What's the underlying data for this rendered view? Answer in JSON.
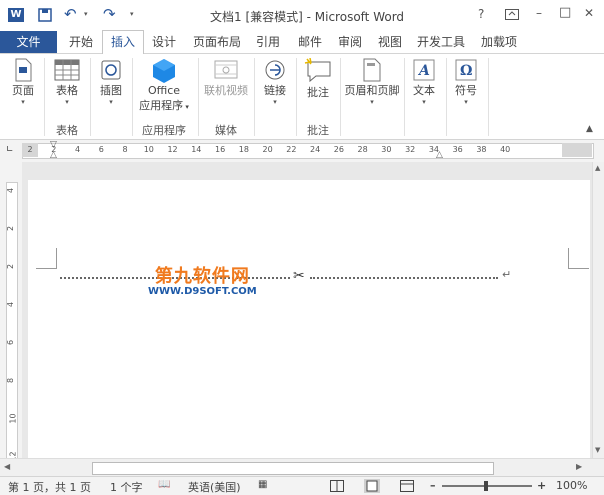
{
  "window": {
    "title": "文档1 [兼容模式] - Microsoft Word"
  },
  "quick_access": {
    "app_icon": "word-icon",
    "save_icon": "save-icon",
    "undo_icon": "undo-icon",
    "redo_icon": "redo-icon"
  },
  "window_controls": {
    "help": "?",
    "ribbon_display": "ribbon-display-icon",
    "minimize": "–",
    "maximize": "□",
    "close": "✕"
  },
  "tabs": [
    {
      "label": "文件"
    },
    {
      "label": "开始"
    },
    {
      "label": "插入"
    },
    {
      "label": "设计"
    },
    {
      "label": "页面布局"
    },
    {
      "label": "引用"
    },
    {
      "label": "邮件"
    },
    {
      "label": "审阅"
    },
    {
      "label": "视图"
    },
    {
      "label": "开发工具"
    },
    {
      "label": "加载项"
    }
  ],
  "active_tab": "插入",
  "ribbon": {
    "pages_label": "页面",
    "table_label": "表格",
    "table_group": "表格",
    "illustrations_label": "插图",
    "office_label_1": "Office",
    "office_label_2": "应用程序",
    "apps_group": "应用程序",
    "video_label": "联机视频",
    "media_group": "媒体",
    "links_label": "链接",
    "comment_label": "批注",
    "comments_group": "批注",
    "header_footer_label": "页眉和页脚",
    "text_label": "文本",
    "symbols_label": "符号"
  },
  "ruler": {
    "ticks": [
      "2",
      "2",
      "4",
      "6",
      "8",
      "10",
      "12",
      "14",
      "16",
      "18",
      "20",
      "22",
      "24",
      "26",
      "28",
      "30",
      "32",
      "34",
      "36",
      "38",
      "40"
    ]
  },
  "vruler": {
    "ticks": [
      "4",
      "2",
      "2",
      "4",
      "6",
      "8",
      "10",
      "12"
    ]
  },
  "watermark": {
    "line1": "第九软件网",
    "line2": "WWW.D9SOFT.COM"
  },
  "status": {
    "page": "第 1 页，共 1 页",
    "words": "1 个字",
    "language": "英语(美国)",
    "zoom": "100%"
  },
  "colors": {
    "brand": "#2b579a",
    "watermark": "#f07a1e"
  }
}
